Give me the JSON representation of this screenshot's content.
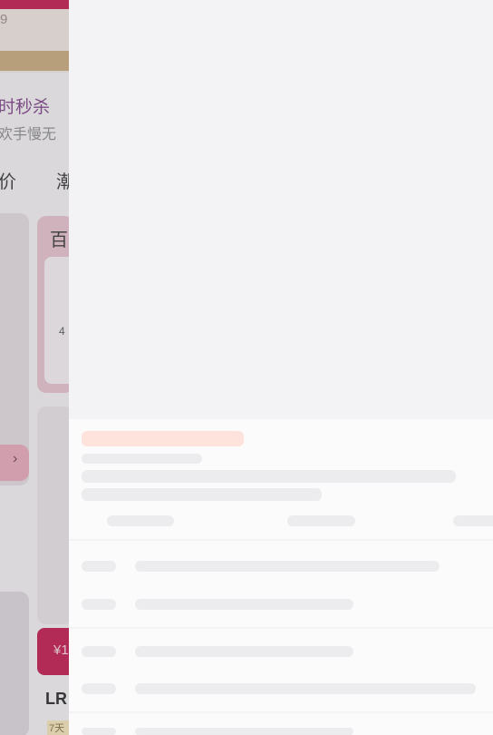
{
  "background_page": {
    "top_number": "9",
    "section_title": "时秒杀",
    "section_subtitle": "欢手慢无",
    "tab_1": "价",
    "tab_2": "潮",
    "card_label": "百",
    "card_mark": "4",
    "chevron": "›",
    "price_symbol": "¥1",
    "product_name": "LR",
    "product_tag": "7天"
  },
  "skeleton": {
    "state": "loading",
    "accent_color": "#fde3dc",
    "placeholder_color": "#ececef"
  }
}
